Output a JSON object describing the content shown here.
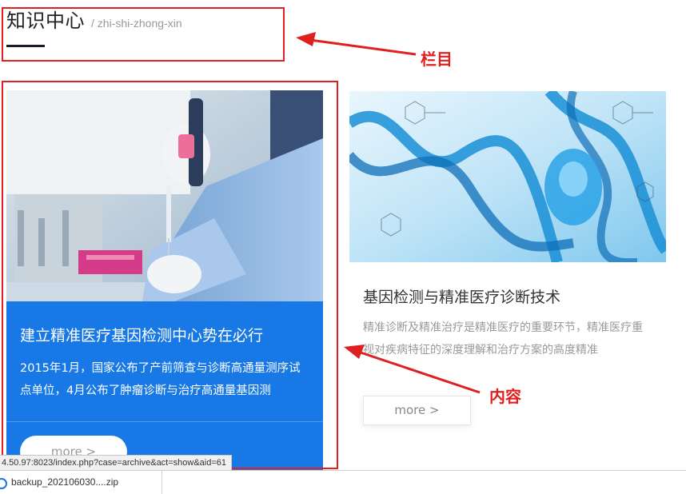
{
  "section": {
    "title": "知识中心",
    "subtitle": "/ zhi-shi-zhong-xin"
  },
  "annotations": {
    "column_label": "栏目",
    "content_label": "内容",
    "color": "#e02020"
  },
  "cards": [
    {
      "image_icon": "lab-pipette-photo",
      "title": "建立精准医疗基因检测中心势在必行",
      "description": "2015年1月，国家公布了产前筛查与诊断高通量测序试点单位，4月公布了肿瘤诊断与治疗高通量基因测",
      "more_label": "more >",
      "accent": "#1778e6"
    },
    {
      "image_icon": "dna-helix-photo",
      "title": "基因检测与精准医疗诊断技术",
      "description": "精准诊断及精准治疗是精准医疗的重要环节，精准医疗重视对疾病特征的深度理解和治疗方案的高度精准",
      "more_label": "more >"
    }
  ],
  "status_bar": {
    "url": "4.50.97:8023/index.php?case=archive&act=show&aid=61"
  },
  "downloads": {
    "items": [
      {
        "filename": "backup_202106030....zip"
      }
    ]
  }
}
